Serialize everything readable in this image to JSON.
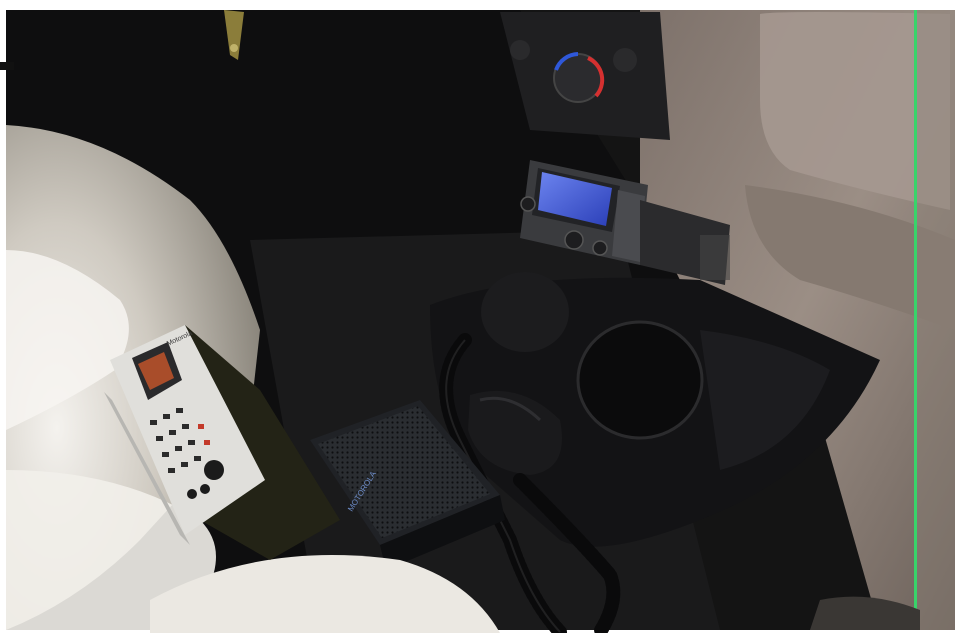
{
  "photo": {
    "palette": {
      "interior_dark": "#121212",
      "seat_fabric": "#c9c4ba",
      "carpet": "#1c1c1c",
      "dashboard": "#9a8d84",
      "lcd_blue": "#3e5bd8",
      "scan_line_green": "#38d46a"
    }
  },
  "labels": {
    "control_head_brand": "Motorola",
    "speaker_brand": "MOTOROLA"
  }
}
